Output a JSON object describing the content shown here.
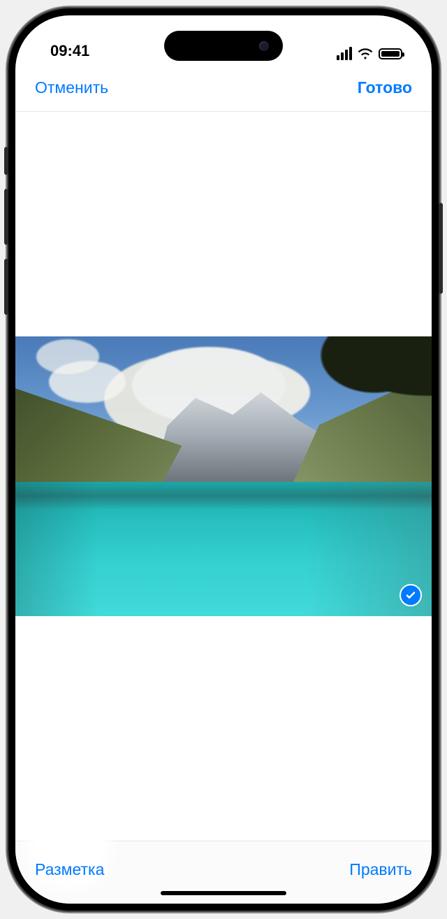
{
  "status": {
    "time": "09:41"
  },
  "nav": {
    "cancel": "Отменить",
    "done": "Готово"
  },
  "toolbar": {
    "markup": "Разметка",
    "edit": "Править"
  },
  "photo": {
    "selected": true
  },
  "icons": {
    "cellular": "cellular-icon",
    "wifi": "wifi-icon",
    "battery": "battery-icon",
    "check": "checkmark-icon"
  }
}
